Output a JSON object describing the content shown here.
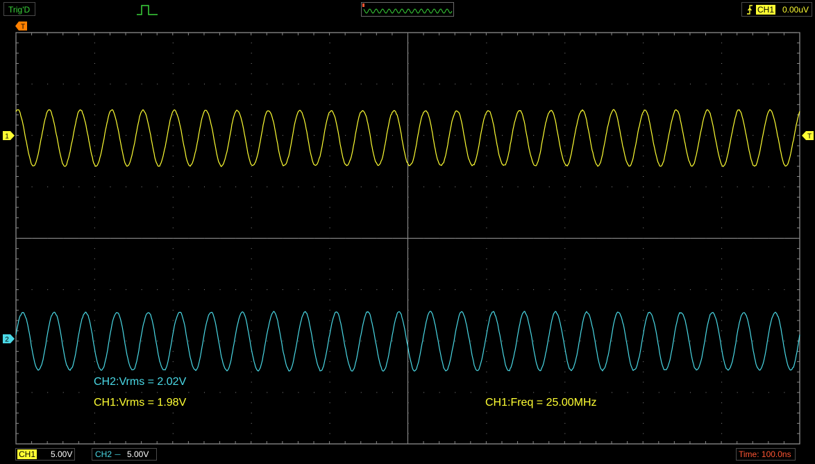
{
  "top_bar": {
    "trigger_status": "Trig'D",
    "icons": {
      "pulse": "single-pulse-icon",
      "edge": "rising-edge-icon"
    },
    "trigger_source": "CH1",
    "trigger_level": "0.00uV"
  },
  "screen": {
    "trigger_marker_label": "T",
    "ch1_marker_label": "1",
    "ch2_marker_label": "2"
  },
  "measurements": {
    "ch2_vrms": "CH2:Vrms = 2.02V",
    "ch1_vrms": "CH1:Vrms = 1.98V",
    "ch1_freq": "CH1:Freq = 25.00MHz"
  },
  "bottom_bar": {
    "ch1": {
      "label": "CH1",
      "coupling": "----",
      "volts_div": "5.00V"
    },
    "ch2": {
      "label": "CH2",
      "coupling": "----",
      "volts_div": "5.00V"
    },
    "timebase": "Time: 100.0ns"
  },
  "colors": {
    "ch1": "#ffff33",
    "ch2": "#4ad9e6",
    "grid": "#8a8a8a",
    "trigger_status": "#3ad43a",
    "timebase": "#ff5533",
    "marker": "#ff8000"
  },
  "waveforms": {
    "ch1": {
      "shape": "sine",
      "cycles_on_screen": 25
    },
    "ch2": {
      "shape": "sine",
      "cycles_on_screen": 25
    }
  }
}
